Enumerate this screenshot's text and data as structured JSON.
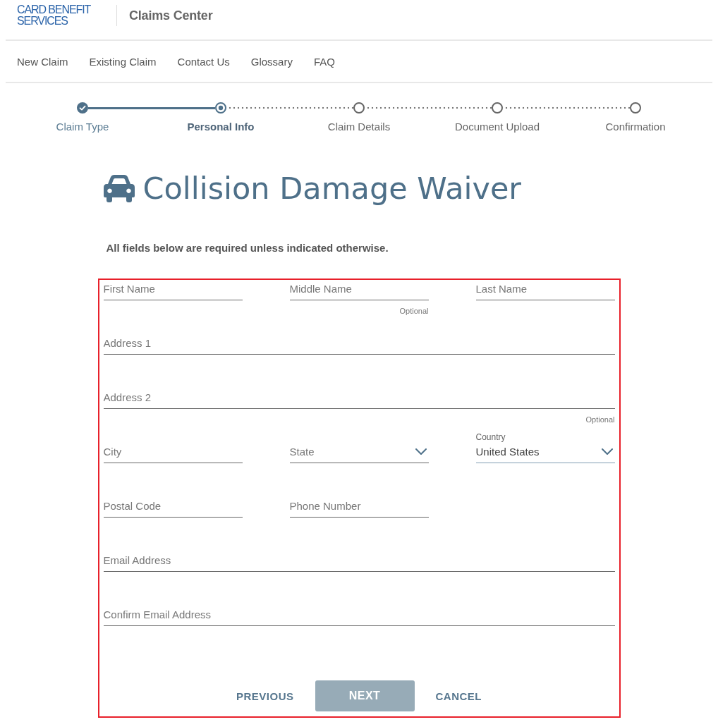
{
  "header": {
    "logo": [
      "CARD BENEFIT",
      "SERVICES"
    ],
    "title": "Claims Center"
  },
  "nav": [
    "New Claim",
    "Existing Claim",
    "Contact Us",
    "Glossary",
    "FAQ"
  ],
  "steps": [
    {
      "label": "Claim Type",
      "completed": true,
      "current": false
    },
    {
      "label": "Personal Info",
      "completed": false,
      "current": true
    },
    {
      "label": "Claim Details",
      "completed": false,
      "current": false
    },
    {
      "label": "Document Upload",
      "completed": false,
      "current": false
    },
    {
      "label": "Confirmation",
      "completed": false,
      "current": false
    }
  ],
  "page": {
    "title": "Collision Damage Waiver",
    "instructions": "All fields below are required unless indicated otherwise."
  },
  "form": {
    "rows": [
      {
        "fields": [
          {
            "kind": "text",
            "placeholder": "First Name"
          },
          {
            "kind": "text",
            "placeholder": "Middle Name",
            "hint": "Optional"
          },
          {
            "kind": "text",
            "placeholder": "Last Name"
          }
        ]
      },
      {
        "fields": [
          {
            "kind": "text",
            "placeholder": "Address 1"
          }
        ]
      },
      {
        "fields": [
          {
            "kind": "text",
            "placeholder": "Address 2",
            "hint": "Optional"
          }
        ]
      },
      {
        "fields": [
          {
            "kind": "text",
            "placeholder": "City"
          },
          {
            "kind": "select",
            "placeholder": "State"
          },
          {
            "kind": "select",
            "label": "Country",
            "value": "United States"
          }
        ]
      },
      {
        "fields": [
          {
            "kind": "text",
            "placeholder": "Postal Code"
          },
          {
            "kind": "text",
            "placeholder": "Phone Number"
          }
        ]
      },
      {
        "fields": [
          {
            "kind": "text",
            "placeholder": "Email Address"
          }
        ]
      },
      {
        "fields": [
          {
            "kind": "text",
            "placeholder": "Confirm Email Address"
          }
        ]
      }
    ],
    "buttons": [
      {
        "kind": "link",
        "label": "PREVIOUS",
        "disabled": false
      },
      {
        "kind": "primary",
        "label": "NEXT",
        "disabled": true
      },
      {
        "kind": "link",
        "label": "CANCEL",
        "disabled": false
      }
    ]
  }
}
